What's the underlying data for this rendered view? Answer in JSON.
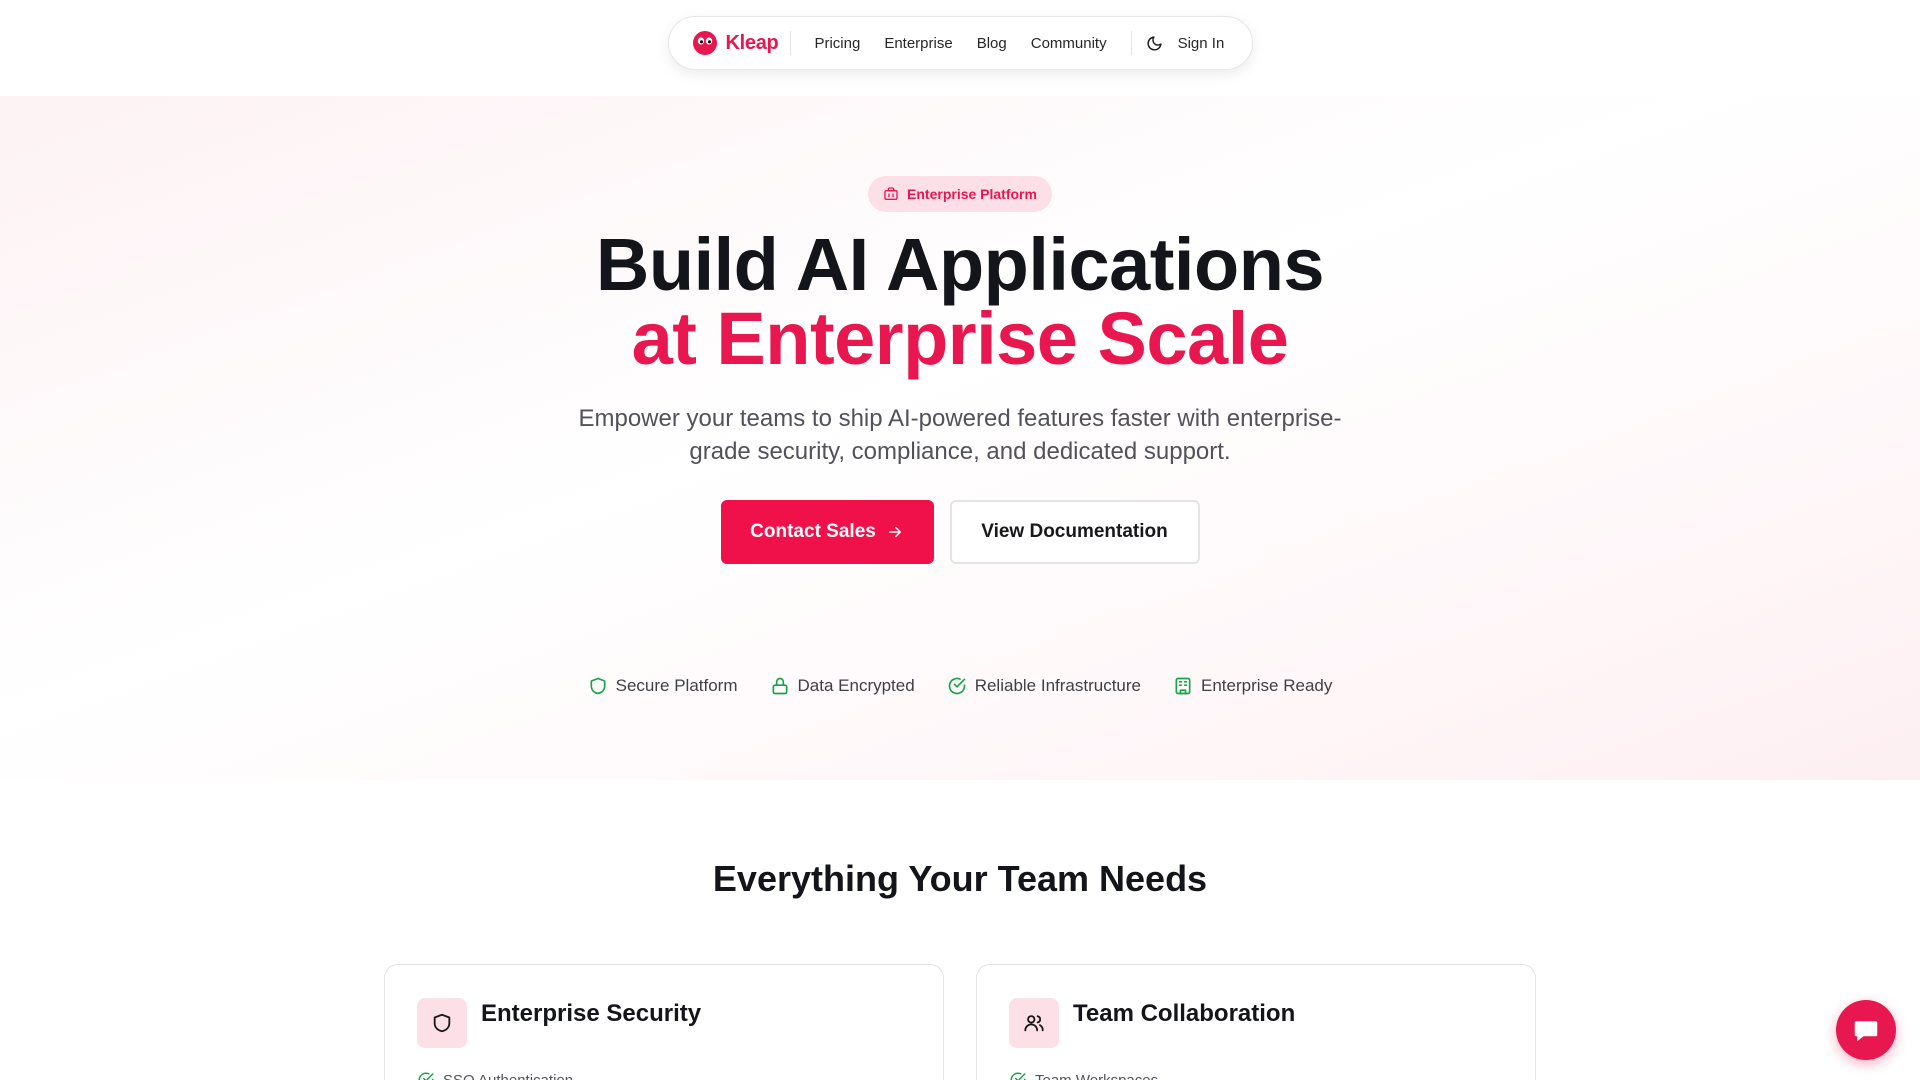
{
  "nav": {
    "brand": "Kleap",
    "links": [
      "Pricing",
      "Enterprise",
      "Blog",
      "Community"
    ],
    "sign_in": "Sign In"
  },
  "hero": {
    "badge": "Enterprise Platform",
    "title_line1": "Build AI Applications",
    "title_line2": "at Enterprise Scale",
    "subtitle": "Empower your teams to ship AI-powered features faster with enterprise-grade security, compliance, and dedicated support.",
    "primary_cta": "Contact Sales",
    "secondary_cta": "View Documentation",
    "trust": [
      "Secure Platform",
      "Data Encrypted",
      "Reliable Infrastructure",
      "Enterprise Ready"
    ]
  },
  "features": {
    "title": "Everything Your Team Needs",
    "cards": [
      {
        "title": "Enterprise Security",
        "item": "SSO Authentication",
        "icon": "shield-icon"
      },
      {
        "title": "Team Collaboration",
        "item": "Team Workspaces",
        "icon": "users-icon"
      }
    ]
  },
  "colors": {
    "brand": "#e8174f",
    "trust_icon": "#16a34a"
  }
}
